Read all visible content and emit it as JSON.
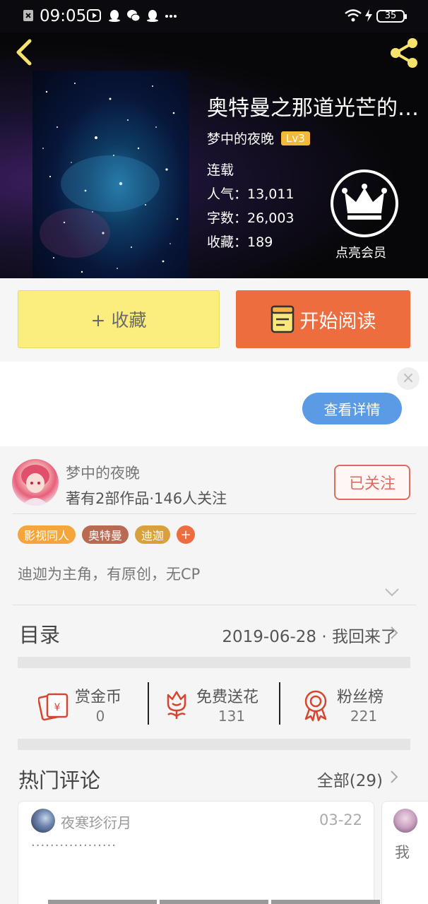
{
  "status_bar": {
    "time": "09:05",
    "battery": "35"
  },
  "book": {
    "title": "奥特曼之那道光芒的…",
    "author": "梦中的夜晚",
    "author_level": "Lv3",
    "status": "连载",
    "popularity_label": "人气：",
    "popularity": "13,011",
    "words_label": "字数：",
    "words": "26,003",
    "favorites_label": "收藏：",
    "favorites": "189"
  },
  "vip": {
    "label": "点亮会员"
  },
  "actions": {
    "collect_label": "+ 收藏",
    "read_label": "开始阅读"
  },
  "ad": {
    "close_glyph": "×",
    "detail_label": "查看详情"
  },
  "author_card": {
    "name": "梦中的夜晚",
    "stats": "著有2部作品·146人关注",
    "follow_label": "已关注"
  },
  "tags": [
    {
      "label": "影视同人",
      "color": "#f4a63b"
    },
    {
      "label": "奥特曼",
      "color": "#b86a52"
    },
    {
      "label": "迪迦",
      "color": "#d8a13c"
    }
  ],
  "tag_add_glyph": "+",
  "summary": "迪迦为主角，有原创，无CP",
  "catalog": {
    "title": "目录",
    "latest": "2019-06-28 · 我回来了"
  },
  "rewards": [
    {
      "label": "赏金币",
      "value": "0",
      "icon": "red-envelope-icon"
    },
    {
      "label": "免费送花",
      "value": "131",
      "icon": "flower-icon"
    },
    {
      "label": "粉丝榜",
      "value": "221",
      "icon": "medal-icon"
    }
  ],
  "comments": {
    "title": "热门评论",
    "all_label": "全部(29)",
    "items": [
      {
        "user": "夜寒珍衍月",
        "date": "03-22",
        "text": "··················"
      },
      {
        "user": "",
        "date": "",
        "text": "我"
      }
    ]
  },
  "colors": {
    "accent_orange": "#ee6d3f",
    "collect_yellow": "#fcee7c",
    "detail_blue": "#5b9be6",
    "follow_red": "#e06a60"
  }
}
